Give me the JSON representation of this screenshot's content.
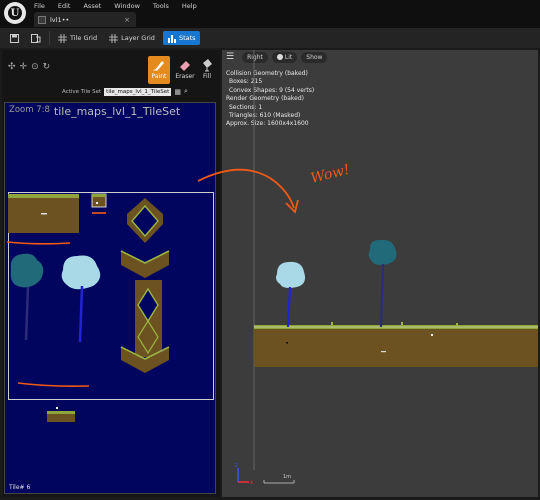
{
  "menu": [
    "File",
    "Edit",
    "Asset",
    "Window",
    "Tools",
    "Help"
  ],
  "document_tab": {
    "label": "lvl1••",
    "close": "×"
  },
  "toolbar": {
    "save_icon": "save-icon",
    "browse_icon": "browse-icon",
    "tile_grid": "Tile Grid",
    "layer_grid": "Layer Grid",
    "stats": "Stats"
  },
  "modes": {
    "paint": "Paint",
    "eraser": "Eraser",
    "fill": "Fill"
  },
  "tileset": {
    "label": "Active Tile Set",
    "value": "tile_maps_lvl_1_TileSet"
  },
  "tile_view": {
    "zoom": "Zoom 7:8",
    "name": "tile_maps_lvl_1_TileSet",
    "tile_number": "Tile# 6"
  },
  "viewport": {
    "buttons": [
      "Right",
      "Lit",
      "Show"
    ],
    "stats": [
      "Collision Geometry (baked)",
      "Boxes: 215",
      "Convex Shapes: 9 (54 verts)",
      "Render Geometry (baked)",
      "Sections: 1",
      "Triangles: 610 (Masked)",
      "Approx. Size: 1600x4x1600"
    ],
    "scale_label": "1m"
  },
  "annotation": {
    "text": "Wow!",
    "color": "#f05a14"
  },
  "colors": {
    "accent": "#1677d2",
    "paint_mode": "#e58a1c",
    "tileset_bg": "#01055e",
    "viewport_bg": "#3c3c3c"
  }
}
